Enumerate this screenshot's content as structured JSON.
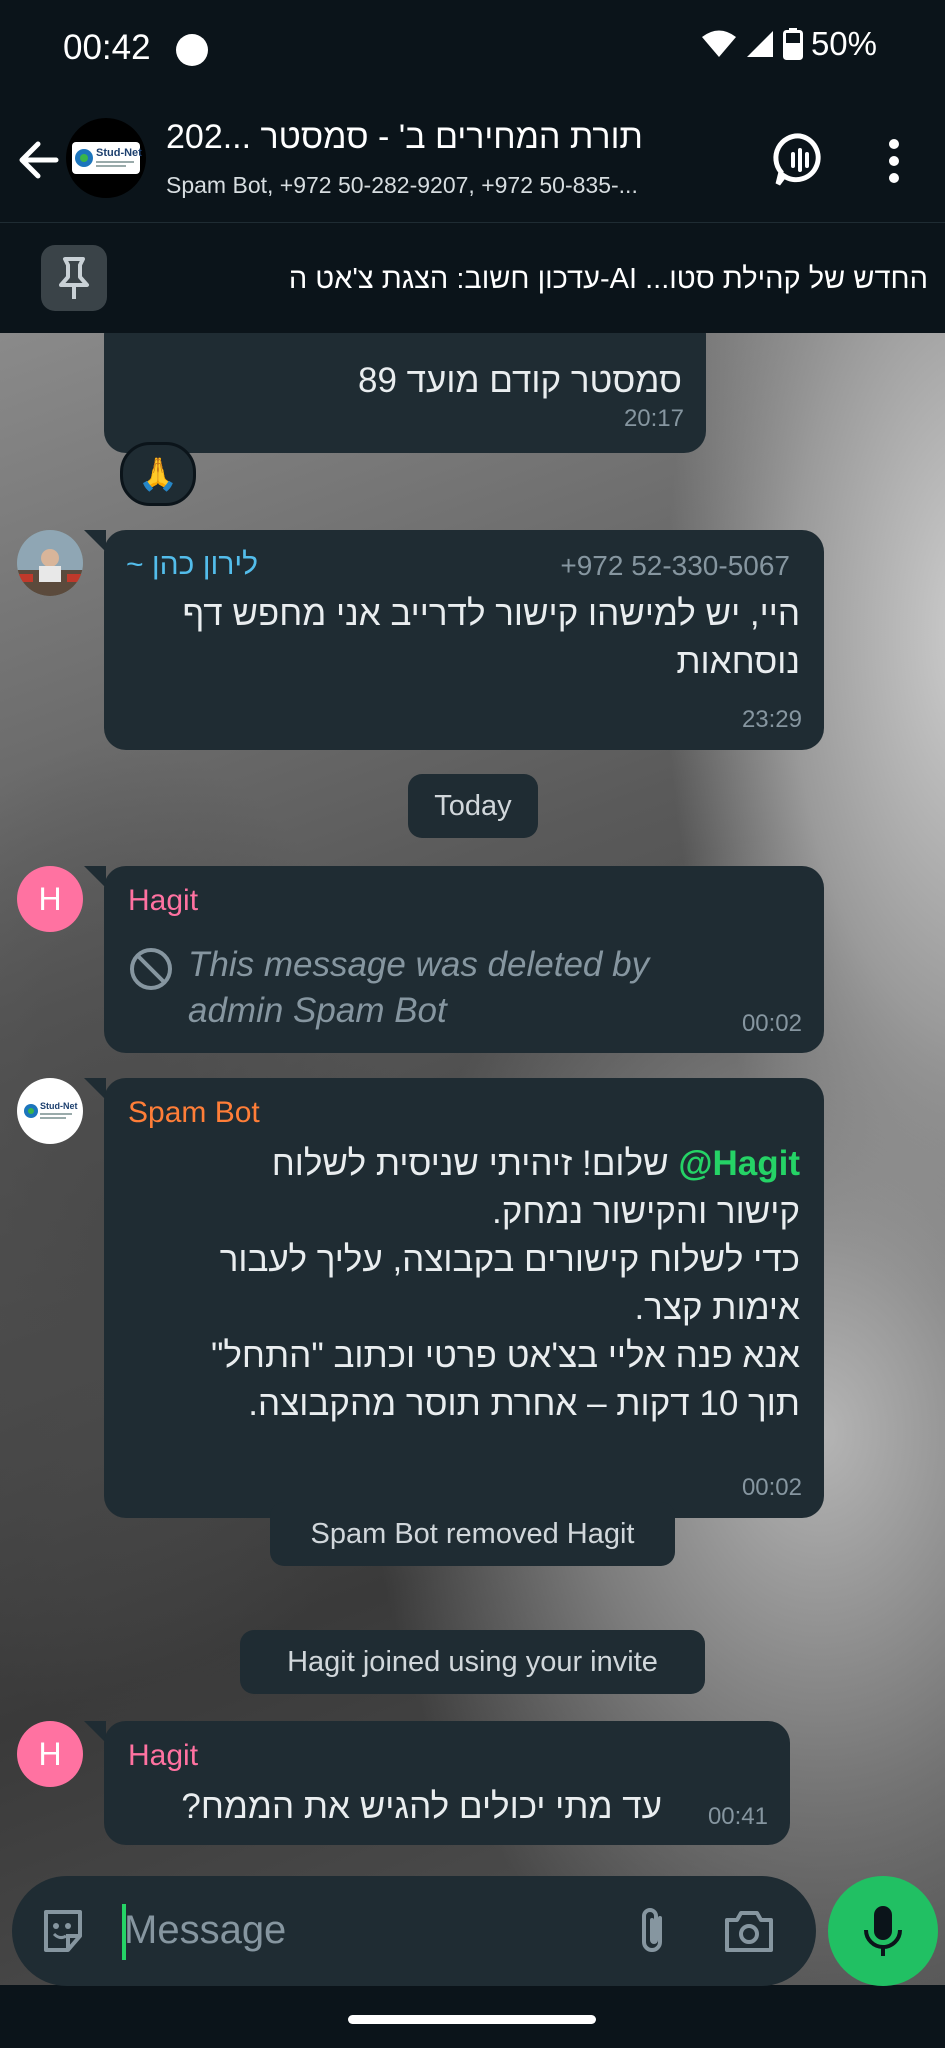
{
  "status_bar": {
    "time": "00:42",
    "battery": "50%"
  },
  "header": {
    "title": "תורת המחירים ב' - סמסטר ...202",
    "subtitle": "Spam Bot, +972 50-282-9207, +972 50-835-...",
    "avatar_label": "Stud-Net"
  },
  "pinned": {
    "text": "החדש של קהילת סטו... AI-עדכון חשוב: הצגת צ'אט ה"
  },
  "messages": {
    "m1": {
      "text": "סמסטר קודם מועד 89",
      "time": "20:17",
      "reaction": "🙏"
    },
    "m2": {
      "sender": "~ לירון כהן",
      "phone": "+972 52-330-5067",
      "text": "היי, יש למישהו קישור לדרייב אני מחפש דף נוסחאות",
      "time": "23:29"
    },
    "date_divider": "Today",
    "m3": {
      "avatar_letter": "H",
      "sender": "Hagit",
      "text": "This message was deleted by admin Spam Bot",
      "time": "00:02"
    },
    "m4": {
      "sender": "Spam Bot",
      "avatar_label": "Stud-Net",
      "mention": "Hagit@",
      "line1": "שלום! זיהיתי שניסית לשלוח",
      "line2": "קישור והקישור נמחק.",
      "line3": "כדי לשלוח קישורים בקבוצה, עליך לעבור",
      "line4": "אימות קצר.",
      "line5": "אנא פנה אליי בצ'אט פרטי וכתוב \"התחל\"",
      "line6": "תוך 10 דקות – אחרת תוסר מהקבוצה.",
      "time": "00:02"
    },
    "sys1": "Spam Bot removed Hagit",
    "sys2": "Hagit joined using your invite",
    "m5": {
      "avatar_letter": "H",
      "sender": "Hagit",
      "text": "עד מתי יכולים להגיש את הממח?",
      "time": "00:41"
    }
  },
  "input": {
    "placeholder": "Message"
  },
  "colors": {
    "accent_green": "#21c063",
    "bubble": "#1f2c33",
    "sender_pink": "#ff72a1",
    "sender_orange": "#ff7e38",
    "sender_blue": "#53bdeb"
  }
}
